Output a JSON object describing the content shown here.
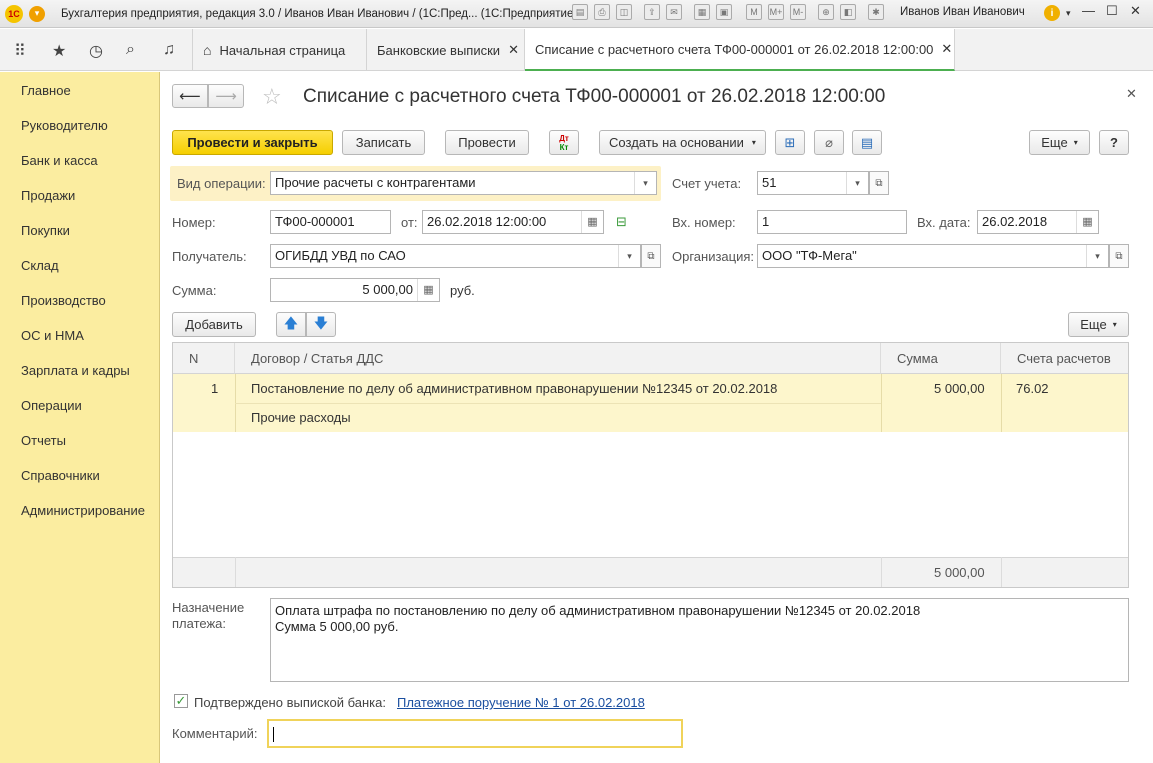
{
  "titlebar": {
    "title": "Бухгалтерия предприятия, редакция 3.0 / Иванов Иван Иванович / (1С:Пред...  (1С:Предприятие)",
    "user": "Иванов Иван Иванович",
    "logo": "1С"
  },
  "tabs": {
    "home": "Начальная страница",
    "bank": "Банковские выписки",
    "current": "Списание с расчетного счета ТФ00-000001 от 26.02.2018 12:00:00"
  },
  "sidebar": {
    "items": [
      {
        "label": "Главное"
      },
      {
        "label": "Руководителю"
      },
      {
        "label": "Банк и касса"
      },
      {
        "label": "Продажи"
      },
      {
        "label": "Покупки"
      },
      {
        "label": "Склад"
      },
      {
        "label": "Производство"
      },
      {
        "label": "ОС и НМА"
      },
      {
        "label": "Зарплата и кадры"
      },
      {
        "label": "Операции"
      },
      {
        "label": "Отчеты"
      },
      {
        "label": "Справочники"
      },
      {
        "label": "Администрирование"
      }
    ]
  },
  "form": {
    "title": "Списание с расчетного счета ТФ00-000001 от 26.02.2018 12:00:00",
    "buttons": {
      "post_close": "Провести и закрыть",
      "save": "Записать",
      "post": "Провести",
      "create_based": "Создать на основании",
      "more": "Еще",
      "help": "?",
      "add": "Добавить",
      "dtkt_top": "Дт",
      "dtkt_bottom": "Кт"
    },
    "labels": {
      "operation": "Вид операции:",
      "account": "Счет учета:",
      "number": "Номер:",
      "from": "от:",
      "in_number": "Вх. номер:",
      "in_date": "Вх. дата:",
      "recipient": "Получатель:",
      "organization": "Организация:",
      "sum": "Сумма:",
      "currency": "руб.",
      "purpose_line1": "Назначение",
      "purpose_line2": "платежа:",
      "confirmed": "Подтверждено выпиской банка:",
      "comment": "Комментарий:"
    },
    "values": {
      "operation": "Прочие расчеты с контрагентами",
      "account": "51",
      "number": "ТФ00-000001",
      "date": "26.02.2018 12:00:00",
      "in_number": "1",
      "in_date": "26.02.2018",
      "recipient": "ОГИБДД УВД по САО",
      "organization": "ООО \"ТФ-Мега\"",
      "sum": "5 000,00",
      "purpose_line1": "Оплата штрафа по постановлению по делу об административном правонарушении №12345 от 20.02.2018",
      "purpose_line2": "Сумма 5 000,00 руб.",
      "payment_link": "Платежное поручение № 1 от 26.02.2018",
      "comment": ""
    },
    "confirmed": true
  },
  "table": {
    "columns": [
      "N",
      "Договор / Статья ДДС",
      "Сумма",
      "Счета расчетов"
    ],
    "rows": [
      {
        "n": "1",
        "contract": "Постановление по делу об административном правонарушении №12345 от 20.02.2018",
        "article": "Прочие расходы",
        "sum": "5 000,00",
        "account": "76.02"
      }
    ],
    "total": "5 000,00"
  }
}
